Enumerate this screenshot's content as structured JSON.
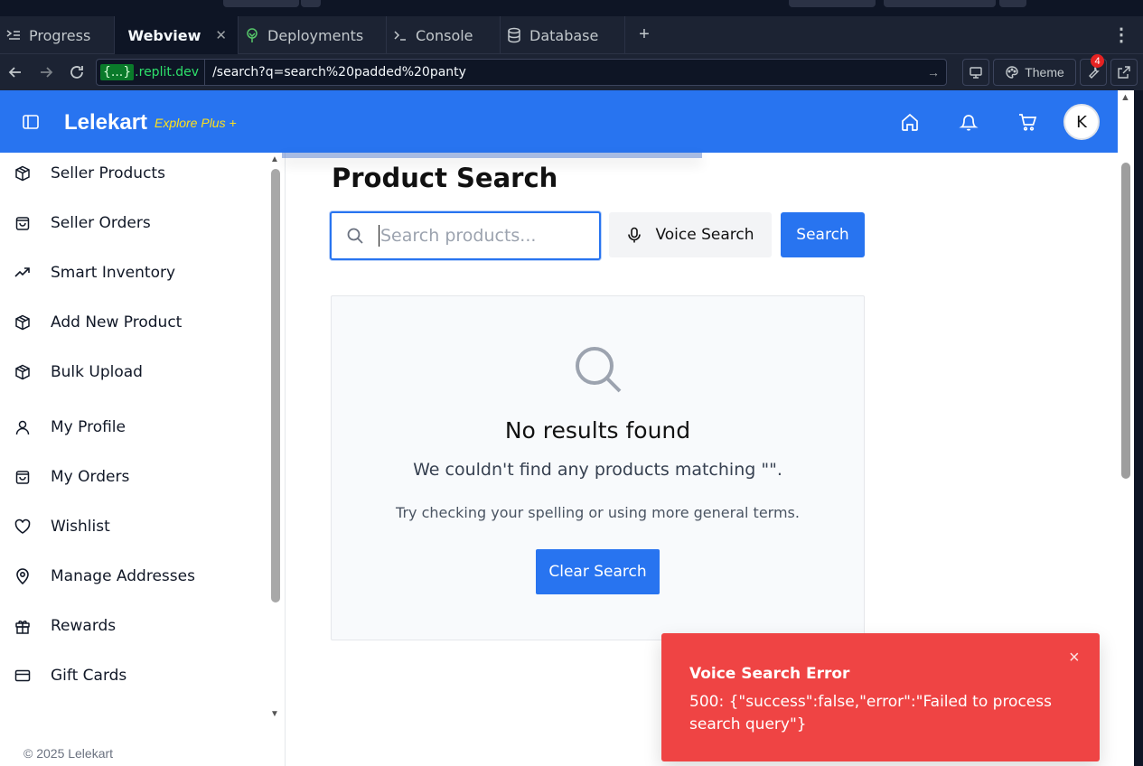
{
  "ide": {
    "tabs": [
      {
        "label": "Progress",
        "icon": "progress-icon"
      },
      {
        "label": "Webview",
        "icon": "monitor-icon",
        "active": true
      },
      {
        "label": "Deployments",
        "icon": "deployments-icon"
      },
      {
        "label": "Console",
        "icon": "terminal-icon"
      },
      {
        "label": "Database",
        "icon": "database-icon"
      }
    ],
    "add_tab": "+",
    "url": {
      "domain_braces": "{...}",
      "domain": ".replit.dev",
      "path": "/search?q=search%20padded%20panty"
    },
    "theme_label": "Theme",
    "tools_badge": "4",
    "colors": {
      "bg": "#0e1525",
      "panel": "#1c2333",
      "domain": "#2ee06b"
    }
  },
  "app": {
    "brand": "Lelekart",
    "brand_sub": "Explore Plus",
    "brand_plus": "+",
    "avatar_initial": "K",
    "colors": {
      "primary": "#2874f0",
      "accent": "#ffe11b",
      "error": "#ef4444"
    },
    "sidebar": {
      "items": [
        {
          "label": "Seller Products",
          "icon": "package-icon"
        },
        {
          "label": "Seller Orders",
          "icon": "shopping-bag-icon"
        },
        {
          "label": "Smart Inventory",
          "icon": "trending-up-icon"
        },
        {
          "label": "Add New Product",
          "icon": "package-icon"
        },
        {
          "label": "Bulk Upload",
          "icon": "package-icon"
        },
        {
          "label": "My Profile",
          "icon": "user-icon"
        },
        {
          "label": "My Orders",
          "icon": "shopping-bag-icon"
        },
        {
          "label": "Wishlist",
          "icon": "heart-icon"
        },
        {
          "label": "Manage Addresses",
          "icon": "map-pin-icon"
        },
        {
          "label": "Rewards",
          "icon": "gift-icon"
        },
        {
          "label": "Gift Cards",
          "icon": "credit-card-icon"
        }
      ],
      "footer": "© 2025 Lelekart"
    },
    "search": {
      "title": "Product Search",
      "placeholder": "Search products...",
      "value": "",
      "voice_label": "Voice Search",
      "button_label": "Search"
    },
    "empty": {
      "title": "No results found",
      "message": "We couldn't find any products matching \"\".",
      "hint": "Try checking your spelling or using more general terms.",
      "clear_label": "Clear Search"
    },
    "toast": {
      "title": "Voice Search Error",
      "message": "500: {\"success\":false,\"error\":\"Failed to process search query\"}",
      "close": "×"
    }
  }
}
